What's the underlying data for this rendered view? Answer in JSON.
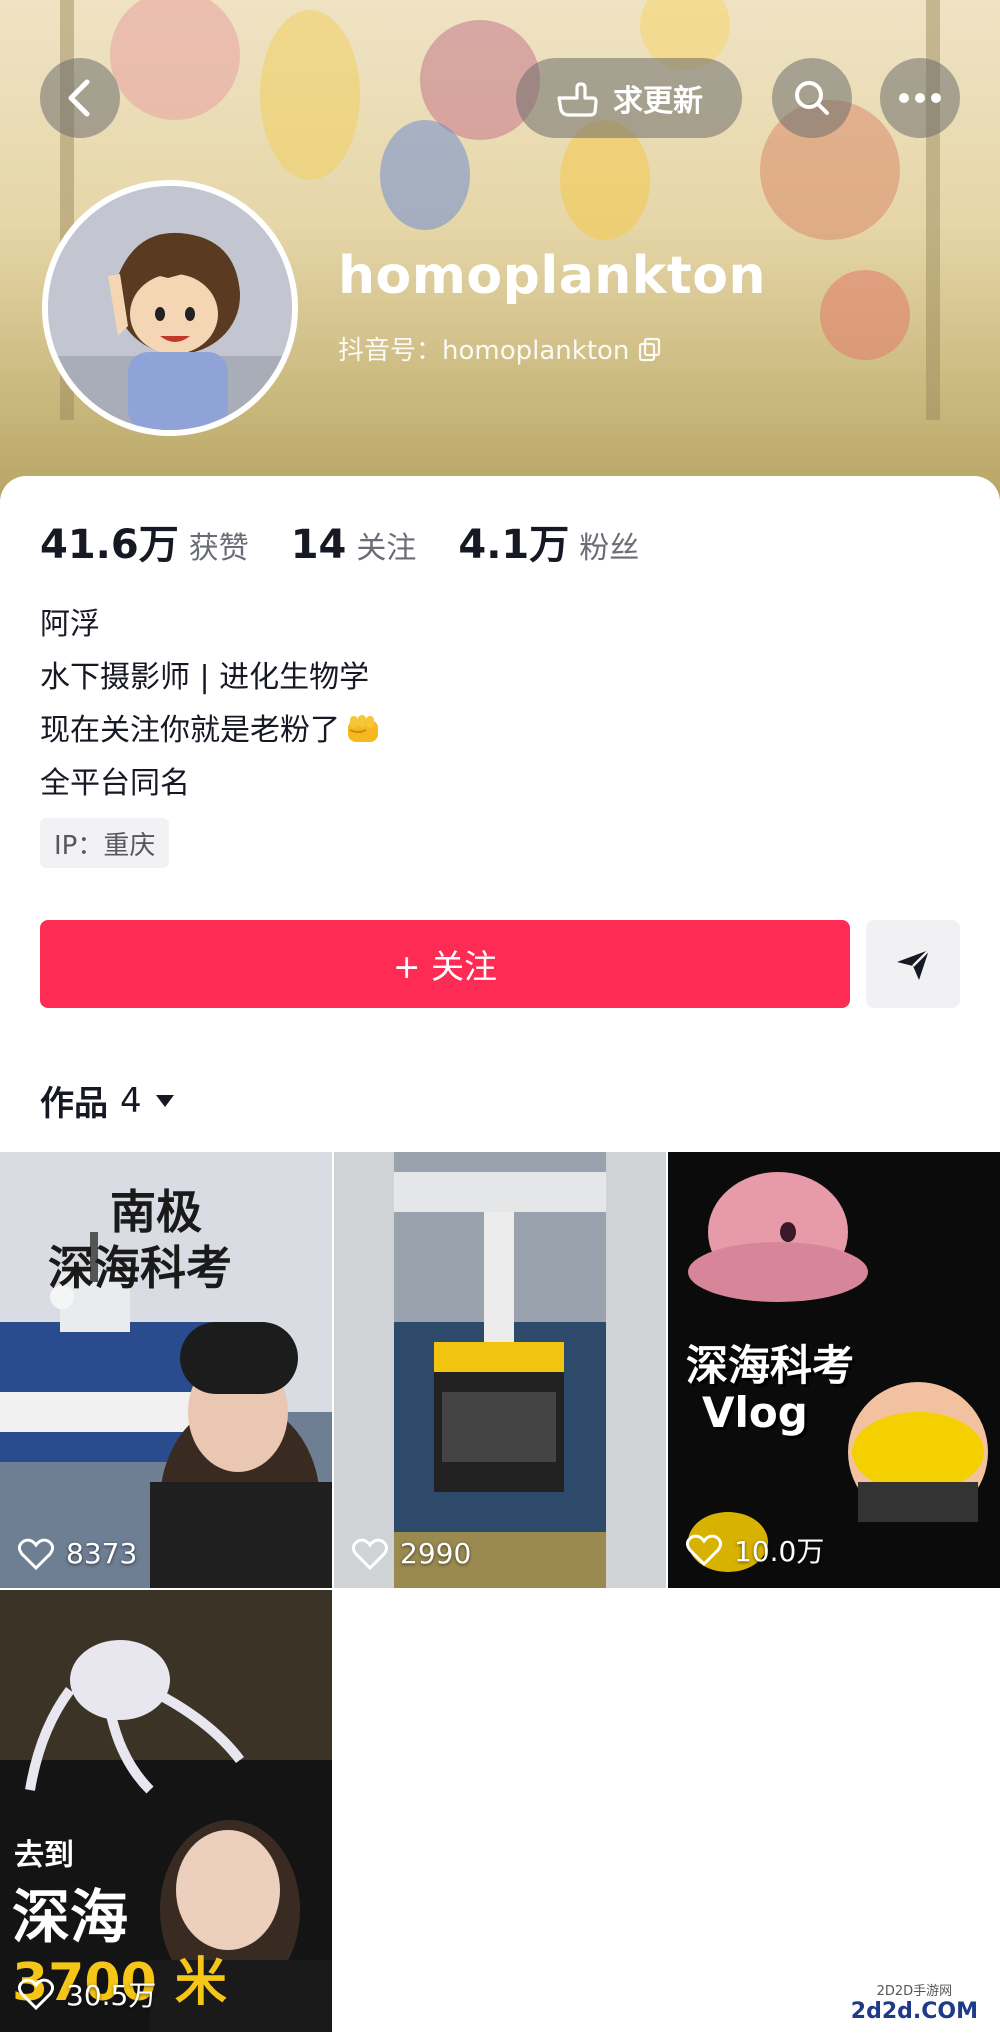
{
  "header": {
    "request_update_label": "求更新",
    "username": "homoplankton",
    "douyin_id": "抖音号：homoplankton"
  },
  "stats": [
    {
      "value": "41.6万",
      "label": "获赞"
    },
    {
      "value": "14",
      "label": "关注"
    },
    {
      "value": "4.1万",
      "label": "粉丝"
    }
  ],
  "bio": {
    "line1": "阿浮",
    "line2": "水下摄影师 | 进化生物学",
    "line3": "现在关注你就是老粉了",
    "line4": "全平台同名"
  },
  "ip_tag": "IP：重庆",
  "actions": {
    "follow_label": "+ 关注"
  },
  "works": {
    "label": "作品",
    "count": "4"
  },
  "videos": [
    {
      "likes": "8373",
      "overlay": [
        "南极",
        "深海科考"
      ]
    },
    {
      "likes": "2990",
      "overlay": []
    },
    {
      "likes": "10.0万",
      "overlay": [
        "深海科考",
        "Vlog"
      ]
    },
    {
      "likes": "30.5万",
      "overlay": [
        "去到",
        "深海",
        "3700 米"
      ]
    }
  ],
  "watermark": {
    "small": "2D2D手游网",
    "big": "2d2d.COM"
  },
  "colors": {
    "accent": "#fe2c55",
    "text": "#161823",
    "muted": "#6b6d76"
  }
}
